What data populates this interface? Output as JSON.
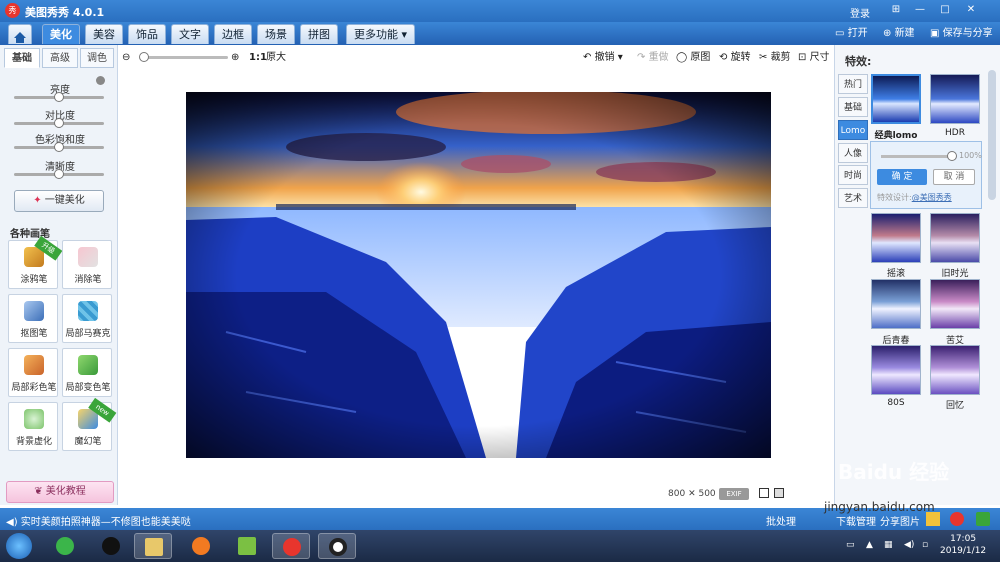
{
  "app": {
    "title": "美图秀秀 4.0.1",
    "logo_text": "秀",
    "login": "登录"
  },
  "window_controls": {
    "skin": "⊞",
    "minimize": "—",
    "maximize": "□",
    "close": "✕"
  },
  "menu": {
    "tabs": [
      "美化",
      "美容",
      "饰品",
      "文字",
      "边框",
      "场景",
      "拼图",
      "更多功能 ▾"
    ],
    "active": "美化",
    "open": "打开",
    "new": "新建",
    "save_share": "保存与分享"
  },
  "toolbar": {
    "zoom_label": "1:1",
    "zoom_original": "原大",
    "zoom_level": 0.05,
    "undo": "撤销",
    "redo": "重做",
    "original": "原图",
    "rotate": "旋转",
    "crop": "裁剪",
    "size": "尺寸"
  },
  "left_panel": {
    "tabs": [
      "基础",
      "高级",
      "调色"
    ],
    "active_tab": "基础",
    "adjustments": [
      {
        "label": "亮度",
        "value": 0.5
      },
      {
        "label": "对比度",
        "value": 0.5
      },
      {
        "label": "色彩饱和度",
        "value": 0.5
      },
      {
        "label": "清晰度",
        "value": 0.5
      }
    ],
    "one_click": "一键美化",
    "brush_title": "各种画笔",
    "brushes": [
      {
        "label": "涂鸦笔",
        "icon": "pencil-icon",
        "badge": "升级"
      },
      {
        "label": "消除笔",
        "icon": "eraser-icon",
        "badge": ""
      },
      {
        "label": "抠图笔",
        "icon": "cutout-pen-icon",
        "badge": ""
      },
      {
        "label": "局部马赛克",
        "icon": "mosaic-icon",
        "badge": ""
      },
      {
        "label": "局部彩色笔",
        "icon": "color-brush-icon",
        "badge": ""
      },
      {
        "label": "局部变色笔",
        "icon": "color-change-icon",
        "badge": ""
      },
      {
        "label": "背景虚化",
        "icon": "blur-icon",
        "badge": ""
      },
      {
        "label": "魔幻笔",
        "icon": "magic-pen-icon",
        "badge": "new"
      }
    ],
    "tutorial": "美化教程"
  },
  "canvas": {
    "width": "800",
    "times": "✕",
    "height": "500",
    "exif": "EXIF"
  },
  "right_panel": {
    "title": "特效:",
    "tabs": [
      "热门",
      "基础",
      "Lomo",
      "人像",
      "时尚",
      "艺术"
    ],
    "active_tab": "Lomo",
    "top_effects": [
      {
        "label": "经典lomo",
        "selected": true
      },
      {
        "label": "HDR",
        "selected": false
      }
    ],
    "popup": {
      "percent": "100%",
      "ok": "确 定",
      "cancel": "取 消",
      "design": "特效设计:",
      "designer": "@美图秀秀"
    },
    "effects": [
      {
        "label": "摇滚"
      },
      {
        "label": "旧时光"
      },
      {
        "label": "后青春"
      },
      {
        "label": "苦艾"
      },
      {
        "label": "80S"
      },
      {
        "label": "回忆"
      }
    ]
  },
  "statusbar": {
    "message": "实时美颜拍照神器—不修图也能美美哒",
    "batch": "批处理",
    "download": "下载管理",
    "share": "分享图片"
  },
  "taskbar": {
    "time": "17:05",
    "date": "2019/1/12"
  },
  "watermark": {
    "line1": "Baidu 经验",
    "line2": "jingyan.baidu.com"
  }
}
